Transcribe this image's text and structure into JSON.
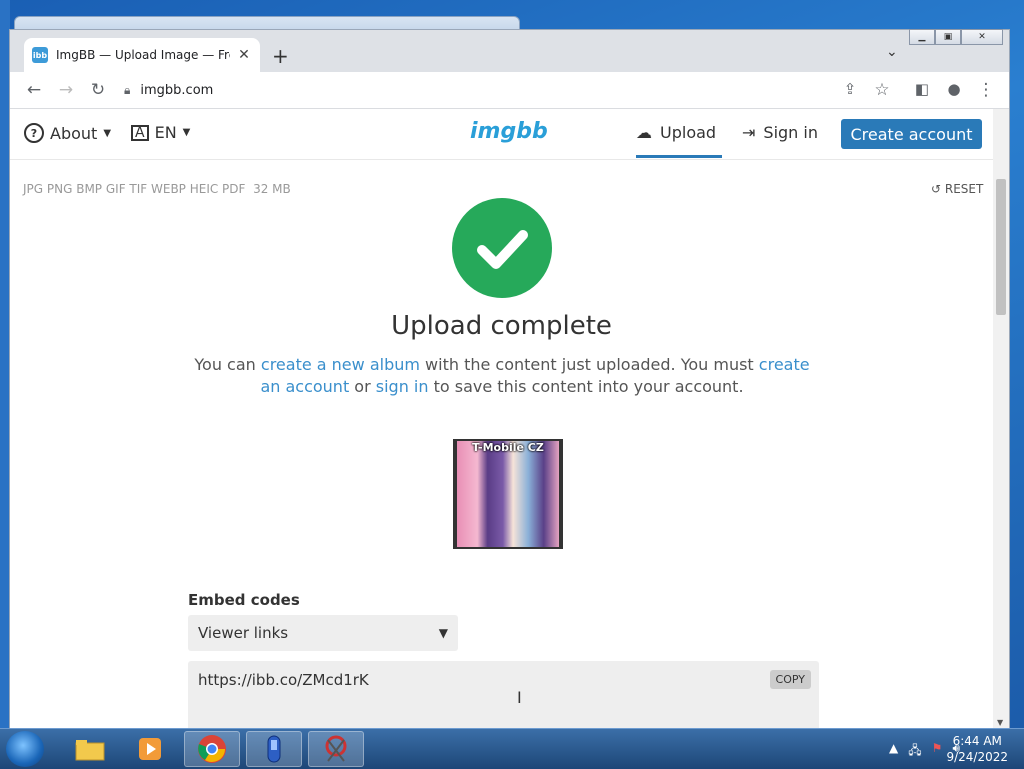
{
  "browser": {
    "tab_title": "ImgBB — Upload Image — Free",
    "tab_favicon_text": "ibb",
    "url": "imgbb.com"
  },
  "site": {
    "logo": "imgbb",
    "nav": {
      "about": "About",
      "language": "EN",
      "upload": "Upload",
      "signin": "Sign in",
      "create_account": "Create account"
    },
    "formats": "JPG PNG BMP GIF TIF WEBP HEIC PDF",
    "max_size": "32 MB",
    "reset": "RESET",
    "heading": "Upload complete",
    "message": {
      "p1": "You can ",
      "link1": "create a new album",
      "p2": " with the content just uploaded. You must ",
      "link2": "create an account",
      "p3": " or ",
      "link3": "sign in",
      "p4": " to save this content into your account."
    },
    "image_caption": "T-Mobile CZ",
    "embed": {
      "label": "Embed codes",
      "selected": "Viewer links",
      "code": "https://ibb.co/ZMcd1rK",
      "copy": "COPY"
    },
    "colors": {
      "accent": "#2a7ab8",
      "success": "#26a95a",
      "link": "#3a8fcc"
    }
  },
  "taskbar": {
    "time": "6:44 AM",
    "date": "9/24/2022",
    "apps": [
      "file-explorer",
      "media-player",
      "chrome",
      "app-blue",
      "snipping-tool"
    ]
  }
}
